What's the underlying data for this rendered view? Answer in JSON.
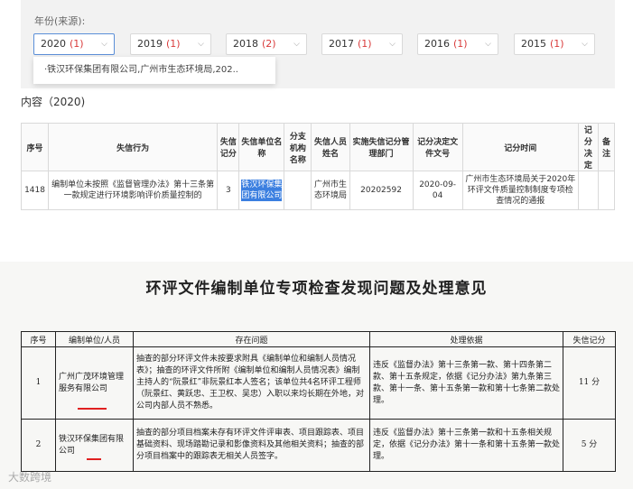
{
  "filter": {
    "label": "年份(来源):",
    "years": [
      {
        "year": "2020",
        "count": "(1)"
      },
      {
        "year": "2019",
        "count": "(1)"
      },
      {
        "year": "2018",
        "count": "(2)"
      },
      {
        "year": "2017",
        "count": "(1)"
      },
      {
        "year": "2016",
        "count": "(1)"
      },
      {
        "year": "2015",
        "count": "(1)"
      }
    ],
    "dropdown_item": "·铁汉环保集团有限公司,广州市生态环境局,202.."
  },
  "content_title": "内容（2020)",
  "web_table": {
    "headers": [
      "序号",
      "失信行为",
      "失信记分",
      "失信单位名称",
      "分支机构名称",
      "失信人员姓名",
      "实施失信记分管理部门",
      "记分决定文件文号",
      "记分时间",
      "记分决定",
      "备注"
    ],
    "row": {
      "no": "1418",
      "behavior": "编制单位未按照《监督管理办法》第十三条第一款规定进行环境影响评价质量控制的",
      "score": "3",
      "unit": "铁汉环保集团有限公司",
      "branch": "",
      "person": "广州市生态环境局",
      "dept": "20202592",
      "doc_no": "2020-09-04",
      "time": "广州市生态环境局关于2020年环评文件质量控制制度专项检查情况的通报",
      "decision": "",
      "note": ""
    }
  },
  "doc": {
    "title": "环评文件编制单位专项检查发现问题及处理意见",
    "headers": [
      "序号",
      "编制单位/人员",
      "存在问题",
      "处理依据",
      "失信记分"
    ],
    "rows": [
      {
        "no": "1",
        "unit": "广州广茂环境管理服务有限公司",
        "problem": "抽查的部分环评文件未按要求附具《编制单位和编制人员情况表》；抽查的环评文件所附《编制单位和编制人员情况表》编制主持人的“阮景红”非阮景红本人签名；该单位共4名环评工程师（阮景红、黄跃忠、王卫权、吴忠）入职以来均长期在外地，对公司内部人员不熟悉。",
        "basis": "违反《监督办法》第十三条第一款、第十四条第二款、第十五条规定，依据《记分办法》第九条第三款、第十一条、第十五条第一款和第十七条第二款处理。",
        "score": "11 分"
      },
      {
        "no": "2",
        "unit": "铁汉环保集团有限公司",
        "problem": "抽查的部分项目档案未存有环评文件评审表、项目跟踪表、项目基础资料、现场踏勘记录和影像资料及其他相关资料；抽查的部分项目档案中的跟踪表无相关人员签字。",
        "basis": "违反《监督办法》第十三条第一款和十五条相关规定，依据《记分办法》第十一条和第十五条第一款处理。",
        "score": "5 分"
      }
    ]
  },
  "watermark": "大数跨境"
}
